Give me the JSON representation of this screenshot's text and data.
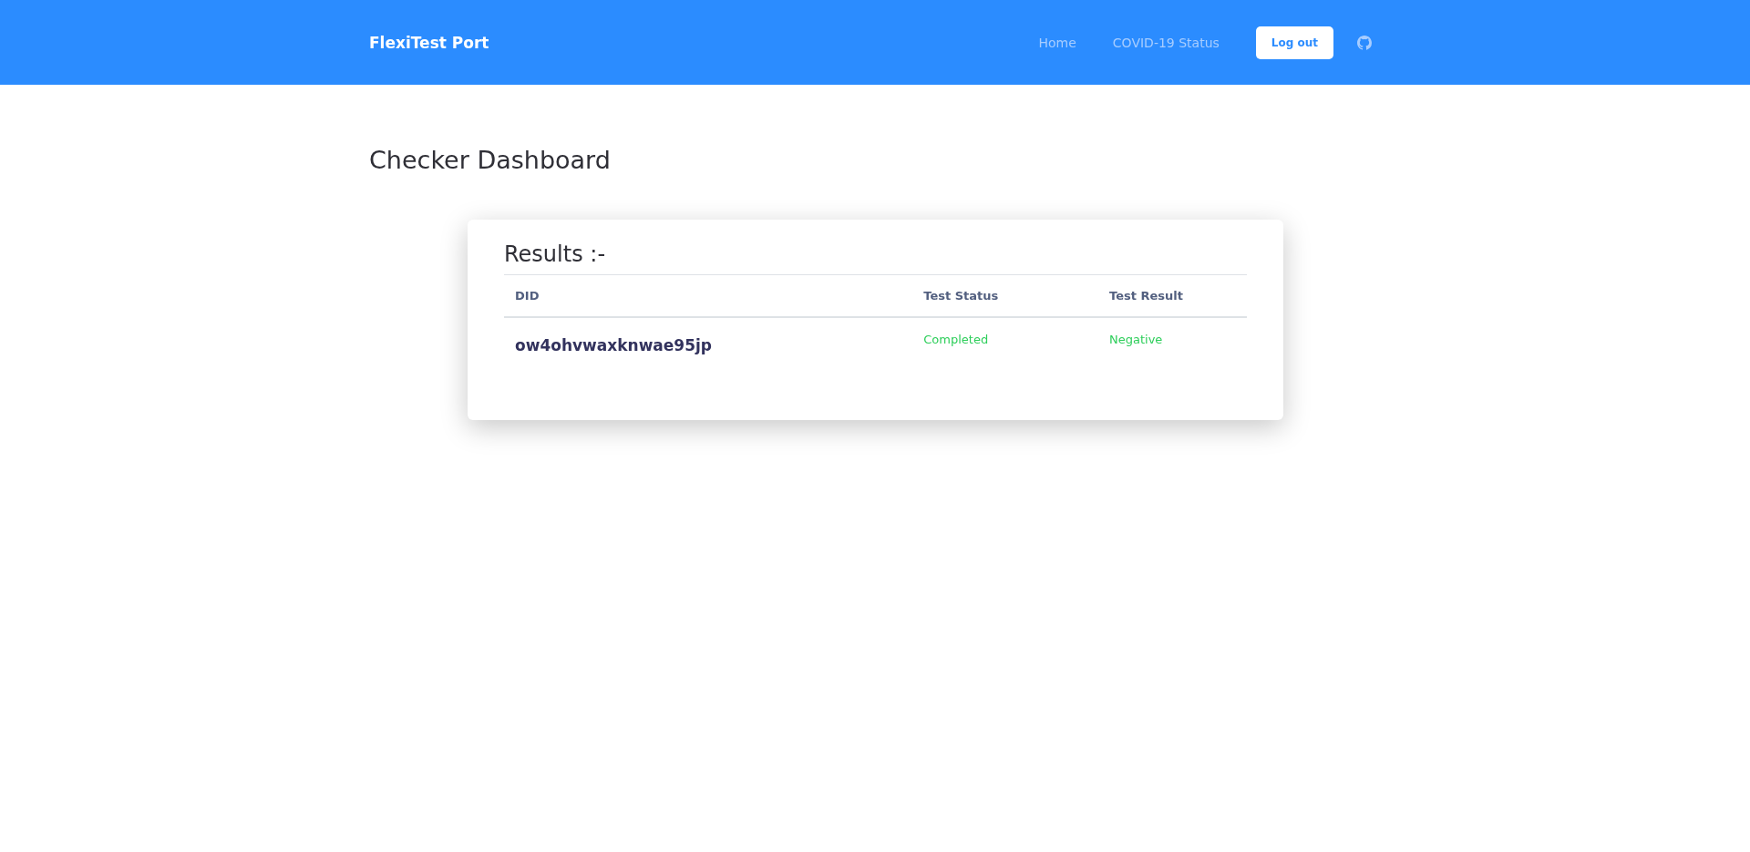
{
  "navbar": {
    "brand": "FlexiTest Port",
    "links": [
      "Home",
      "COVID-19 Status"
    ],
    "button": "Log out"
  },
  "page": {
    "title": "Checker Dashboard"
  },
  "results": {
    "title": "Results :-",
    "columns": [
      "DID",
      "Test Status",
      "Test Result"
    ],
    "rows": [
      {
        "did": "ow4ohvwaxknwae95jp",
        "status": "Completed",
        "result": "Negative"
      }
    ]
  }
}
